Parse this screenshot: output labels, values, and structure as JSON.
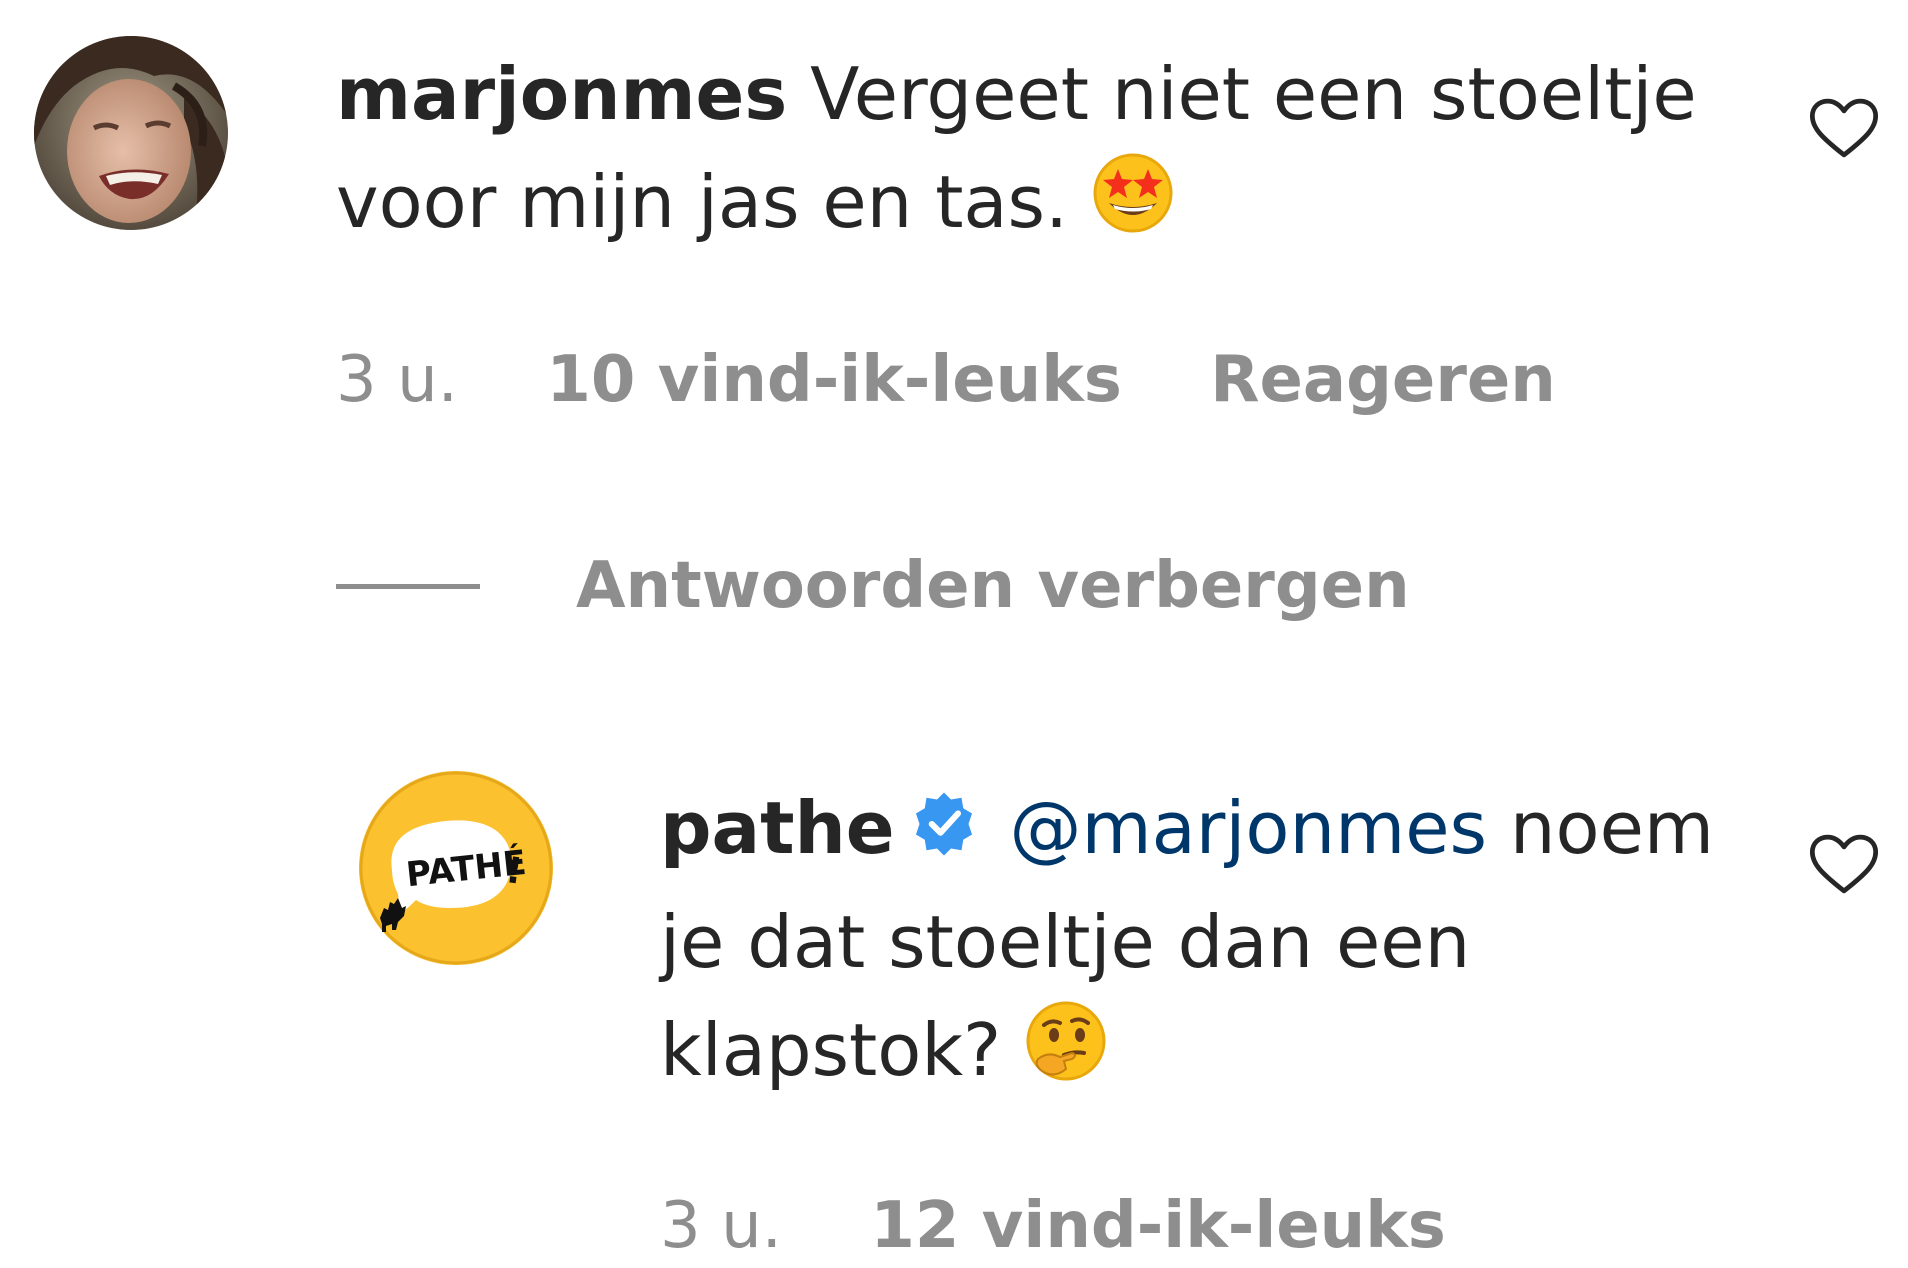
{
  "comment": {
    "username": "marjonmes",
    "text": "Vergeet niet een stoeltje voor mijn jas en tas.",
    "emoji": "star-struck",
    "time": "3 u.",
    "likes": "10 vind-ik-leuks",
    "reply_label": "Reageren"
  },
  "replies_toggle": {
    "label": "Antwoorden verbergen"
  },
  "reply": {
    "username": "pathe",
    "verified": true,
    "mention": "@marjonmes",
    "text": "noem je dat stoeltje dan een klapstok?",
    "emoji": "thinking-face",
    "time": "3 u.",
    "likes": "12 vind-ik-leuks"
  },
  "colors": {
    "text": "#262626",
    "secondary": "#8e8e8e",
    "mention": "#00376b",
    "verified": "#3897f0",
    "pathe_yellow": "#fcc12f"
  }
}
